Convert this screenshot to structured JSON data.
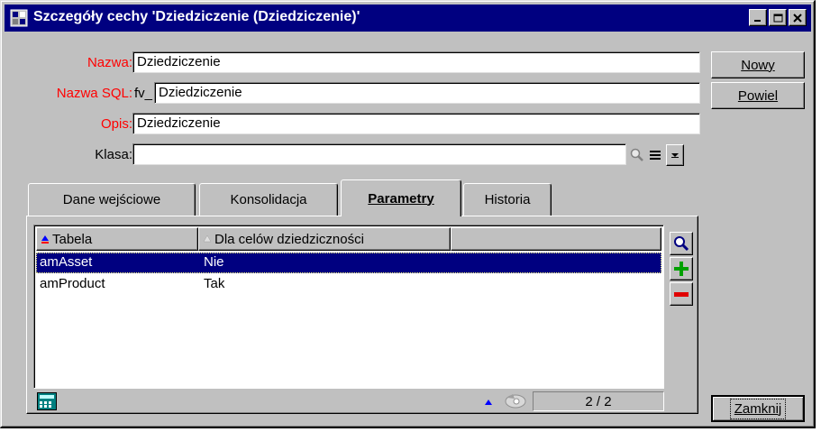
{
  "window": {
    "title": "Szczegóły cechy 'Dziedziczenie (Dziedziczenie)'"
  },
  "form": {
    "name_label": "Nazwa:",
    "name_value": "Dziedziczenie",
    "sql_label": "Nazwa SQL:",
    "sql_prefix": "fv_",
    "sql_value": "Dziedziczenie",
    "desc_label": "Opis:",
    "desc_value": "Dziedziczenie",
    "class_label": "Klasa:",
    "class_value": ""
  },
  "buttons": {
    "new_label": "Nowy",
    "duplicate_label": "Powiel",
    "close_label": "Zamknij"
  },
  "tabs": [
    {
      "label": "Dane wejściowe",
      "active": false
    },
    {
      "label": "Konsolidacja",
      "active": false
    },
    {
      "label": "Parametry",
      "active": true
    },
    {
      "label": "Historia",
      "active": false
    }
  ],
  "table": {
    "columns": [
      "Tabela",
      "Dla celów dziedziczności",
      ""
    ],
    "rows": [
      {
        "table": "amAsset",
        "value": "Nie",
        "selected": true
      },
      {
        "table": "amProduct",
        "value": "Tak",
        "selected": false
      }
    ],
    "counter": "2 / 2"
  },
  "colors": {
    "titlebar": "#000080",
    "required_label": "#ff0000",
    "selection": "#000080"
  }
}
